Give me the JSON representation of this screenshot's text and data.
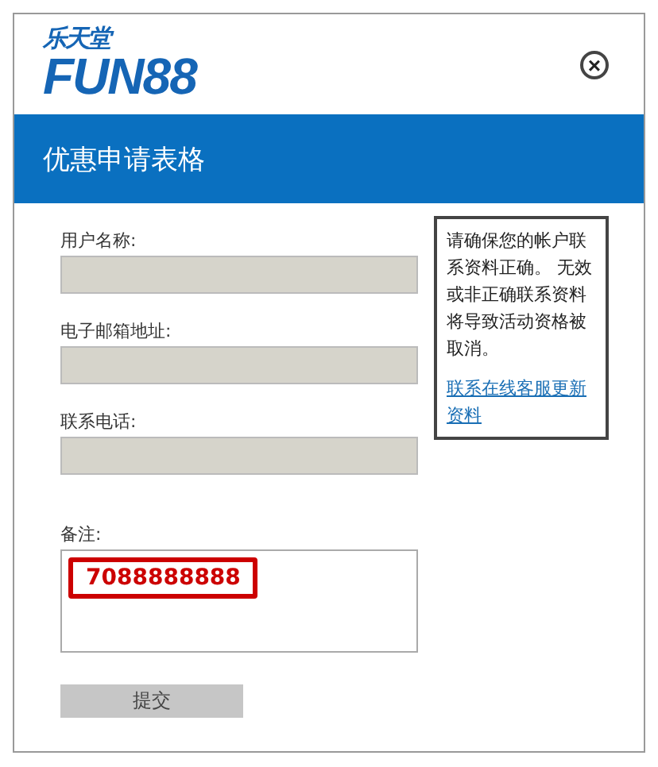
{
  "header": {
    "logo_top": "乐天堂",
    "logo_main": "FUN88",
    "close": "×"
  },
  "title": "优惠申请表格",
  "fields": [
    {
      "label": "用户名称:",
      "disabled": true
    },
    {
      "label": "电子邮箱地址:",
      "disabled": true
    },
    {
      "label": "联系电话:",
      "disabled": true
    }
  ],
  "note": {
    "text": "请确保您的帐户联系资料正确。 无效或非正确联系资料将导致活动资格被取消。",
    "link": "联系在线客服更新资料"
  },
  "remarks": {
    "label": "备注:",
    "value": "7088888888"
  },
  "submit": "提交"
}
